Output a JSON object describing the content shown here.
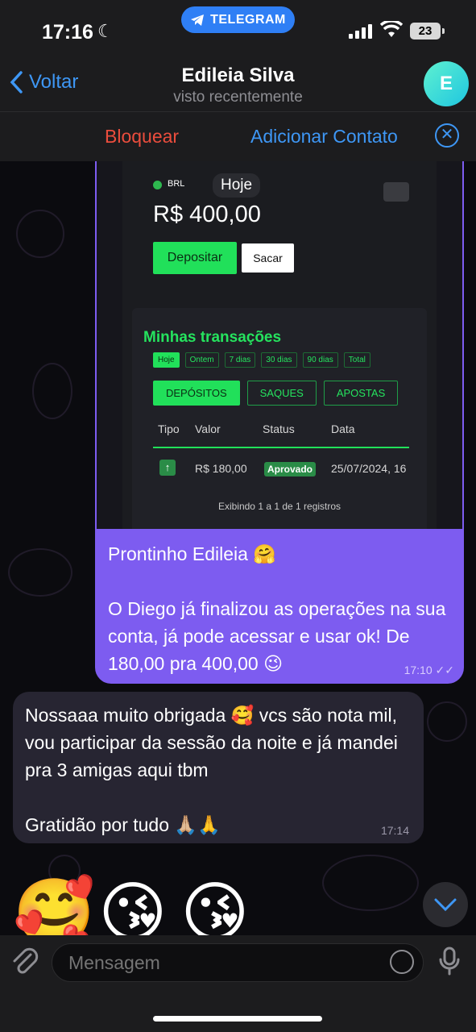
{
  "status": {
    "time": "17:16",
    "app_badge": "TELEGRAM",
    "battery": "23"
  },
  "nav": {
    "back_label": "Voltar",
    "title": "Edileia Silva",
    "subtitle": "visto recentemente",
    "avatar_letter": "E"
  },
  "actions": {
    "block_label": "Bloquear",
    "add_contact_label": "Adicionar Contato"
  },
  "photo": {
    "currency": "BRL",
    "period": "Hoje",
    "balance": "R$ 400,00",
    "deposit_label": "Depositar",
    "withdraw_label": "Sacar",
    "transactions_title": "Minhas transações",
    "filters": [
      "Hoje",
      "Ontem",
      "7 dias",
      "30 dias",
      "90 dias",
      "Total"
    ],
    "tabs": [
      "DEPÓSITOS",
      "SAQUES",
      "APOSTAS"
    ],
    "headers": [
      "Tipo",
      "Valor",
      "Status",
      "Data"
    ],
    "row": {
      "value": "R$ 180,00",
      "status": "Aprovado",
      "date": "25/07/2024, 16"
    },
    "records": "Exibindo 1 a 1 de 1 registros"
  },
  "messages": {
    "outgoing": {
      "text": "Prontinho Edileia 🤗\n\nO Diego já finalizou as operações na sua conta, já pode acessar e usar ok! De 180,00 pra 400,00 😉",
      "time": "17:10"
    },
    "incoming": {
      "text": "Nossaaa muito obrigada 🥰 vcs são nota mil, vou participar da sessão da noite e já mandei pra 3 amigas aqui tbm\n\nGratidão por tudo 🙏🏼🙏",
      "time": "17:14"
    },
    "emojis": [
      "🥰",
      "😘",
      "😘"
    ]
  },
  "composer": {
    "placeholder": "Mensagem"
  },
  "colors": {
    "accent": "#3e97f5",
    "outgoing_bubble": "#7d5cf0",
    "incoming_bubble": "#272532",
    "block_red": "#eb4d3d",
    "app_green": "#21e05a"
  }
}
